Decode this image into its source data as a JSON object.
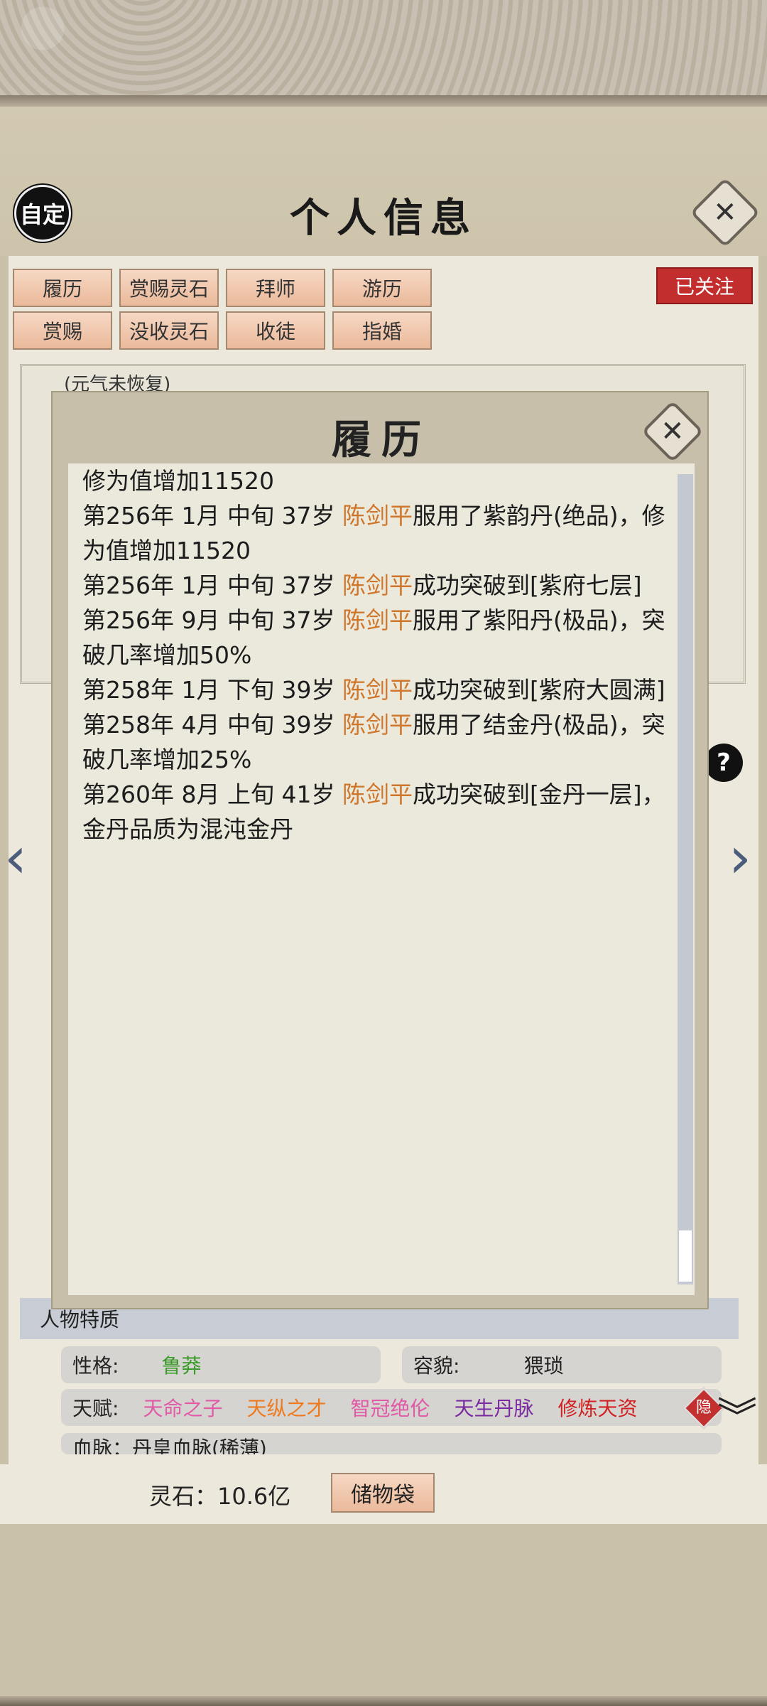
{
  "header": {
    "auto_label": "自定",
    "title": "个人信息",
    "close_icon": "close-icon"
  },
  "tabs": [
    {
      "label": "履历"
    },
    {
      "label": "赏赐灵石"
    },
    {
      "label": "拜师"
    },
    {
      "label": "游历"
    },
    {
      "label": "赏赐"
    },
    {
      "label": "没收灵石"
    },
    {
      "label": "收徒"
    },
    {
      "label": "指婚"
    }
  ],
  "follow_label": "已关注",
  "behind_status": "(元气未恢复)",
  "modal": {
    "title": "履历",
    "close_icon": "close-icon",
    "entries": [
      {
        "text_before": "修为值增加11520",
        "name": "",
        "text_after": ""
      },
      {
        "text_before": "第256年 1月 中旬  37岁  ",
        "name": "陈剑平",
        "text_after": "服用了紫韵丹(绝品)，修为值增加11520"
      },
      {
        "text_before": "第256年 1月 中旬  37岁  ",
        "name": "陈剑平",
        "text_after": "成功突破到[紫府七层]"
      },
      {
        "text_before": "第256年 9月 中旬  37岁  ",
        "name": "陈剑平",
        "text_after": "服用了紫阳丹(极品)，突破几率增加50%"
      },
      {
        "text_before": "第258年 1月 下旬  39岁   ",
        "name": "陈剑平",
        "text_after": "成功突破到[紫府大圆满]"
      },
      {
        "text_before": "第258年 4月 中旬  39岁  ",
        "name": "陈剑平",
        "text_after": "服用了结金丹(极品)，突破几率增加25%"
      },
      {
        "text_before": "第260年  8月  上旬   41岁   ",
        "name": "陈剑平",
        "text_after": "成功突破到[金丹一层]，金丹品质为混沌金丹"
      }
    ]
  },
  "traits": {
    "header": "人物特质",
    "personality_label": "性格:",
    "personality_value": "鲁莽",
    "appearance_label": "容貌:",
    "appearance_value": "猥琐",
    "talent_label": "天赋:",
    "talents": [
      {
        "name": "天命之子",
        "color": "#e05aa8"
      },
      {
        "name": "天纵之才",
        "color": "#ee7a20"
      },
      {
        "name": "智冠绝伦",
        "color": "#e05aa8"
      },
      {
        "name": "天生丹脉",
        "color": "#7a2aa0"
      },
      {
        "name": "修炼天资",
        "color": "#d02222"
      }
    ],
    "hide_label": "隐",
    "bloodline_text": "血脉：丹皇血脉(稀薄)"
  },
  "bottom": {
    "spirit_stone_text": "灵石：10.6亿",
    "bag_label": "储物袋"
  },
  "icons": {
    "left_arrow": "chevron-left-icon",
    "right_arrow": "chevron-right-icon",
    "help": "help-icon",
    "expand": "double-chevron-down-icon"
  }
}
